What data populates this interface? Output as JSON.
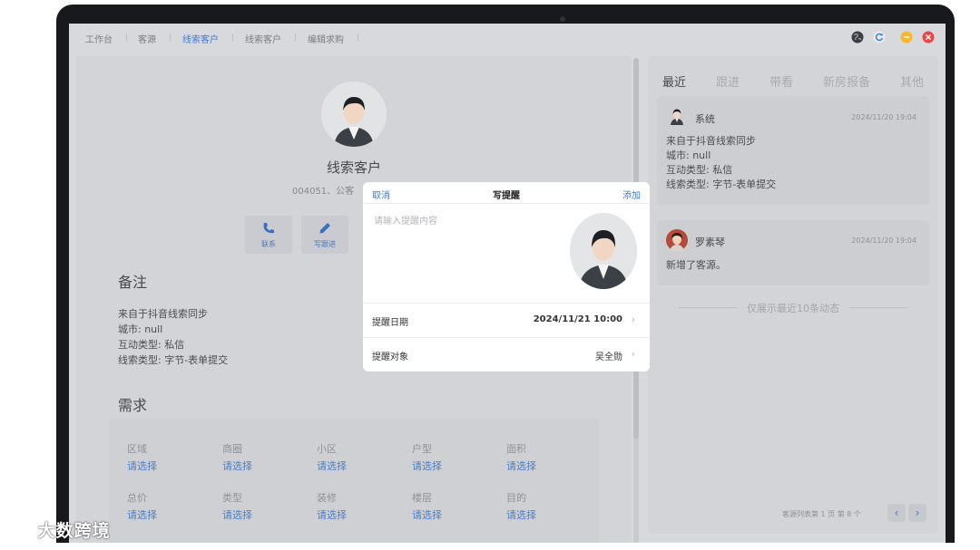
{
  "nav": {
    "tabs": [
      {
        "label": "工作台"
      },
      {
        "label": "客源"
      },
      {
        "label": "线索客户"
      },
      {
        "label": "线索客户"
      },
      {
        "label": "编辑求购"
      }
    ],
    "active_index": 2
  },
  "profile": {
    "name": "线索客户",
    "subtitle": "004051、公客"
  },
  "actions": [
    {
      "label": "联系",
      "icon": "phone-icon"
    },
    {
      "label": "写跟进",
      "icon": "pen-icon"
    }
  ],
  "notes": {
    "title": "备注",
    "lines": [
      "来自于抖音线索同步",
      "城市: null",
      "互动类型: 私信",
      "线索类型: 字节-表单提交"
    ]
  },
  "requirements": {
    "title": "需求",
    "fields": [
      {
        "label": "区域",
        "value": "请选择"
      },
      {
        "label": "商圈",
        "value": "请选择"
      },
      {
        "label": "小区",
        "value": "请选择"
      },
      {
        "label": "户型",
        "value": "请选择"
      },
      {
        "label": "面积",
        "value": "请选择"
      },
      {
        "label": "总价",
        "value": "请选择"
      },
      {
        "label": "类型",
        "value": "请选择"
      },
      {
        "label": "装修",
        "value": "请选择"
      },
      {
        "label": "楼层",
        "value": "请选择"
      },
      {
        "label": "目的",
        "value": "请选择"
      }
    ]
  },
  "activity": {
    "tabs": [
      {
        "label": "最近"
      },
      {
        "label": "跟进"
      },
      {
        "label": "带看"
      },
      {
        "label": "新房报备"
      },
      {
        "label": "其他"
      }
    ],
    "active_index": 0,
    "items": [
      {
        "user": "系统",
        "time": "2024/11/20 19:04",
        "lines": [
          "来自于抖音线索同步",
          "城市: null",
          "互动类型: 私信",
          "线索类型: 字节-表单提交"
        ]
      },
      {
        "user": "罗素琴",
        "time": "2024/11/20 19:04",
        "lines": [
          "新增了客源。"
        ]
      }
    ],
    "only_recent": "仅展示最近10条动态",
    "pager": {
      "text": "客源列表第 1 页 第 8 个",
      "prev": "‹",
      "next": "›"
    }
  },
  "modal": {
    "cancel": "取消",
    "title": "写提醒",
    "add": "添加",
    "placeholder": "请输入提醒内容",
    "date_label": "提醒日期",
    "date_value": "2024/11/21 10:00",
    "target_label": "提醒对象",
    "target_value": "吴全勋"
  },
  "watermark": "大数跨境",
  "colors": {
    "accent": "#3d7ad6",
    "win_yellow": "#f5b82e",
    "win_red": "#ee4545"
  }
}
